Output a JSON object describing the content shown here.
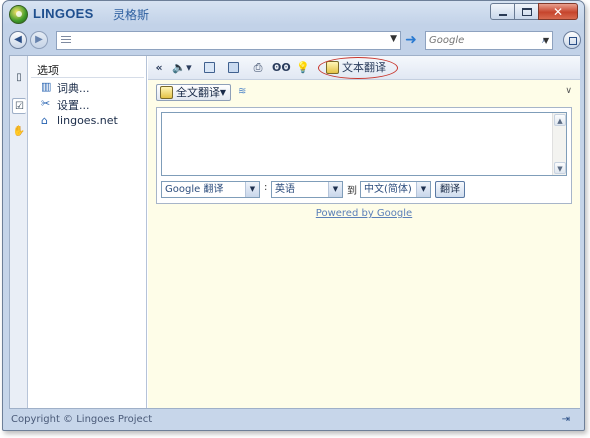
{
  "window": {
    "title": "LINGOES",
    "title_cn": "灵格斯",
    "controls": [
      "minimize",
      "maximize",
      "close"
    ]
  },
  "address": {
    "value": "",
    "search_placeholder": "Google"
  },
  "sidebar": {
    "header": "选项",
    "items": [
      {
        "label": "词典...",
        "icon": "dictionary-icon"
      },
      {
        "label": "设置...",
        "icon": "tools-icon"
      },
      {
        "label": "lingoes.net",
        "icon": "home-icon"
      }
    ]
  },
  "toolbar": {
    "collapse": "«",
    "text_translate": "文本翻译"
  },
  "translate": {
    "mode_label": "全文翻译",
    "engine": "Google 翻译",
    "colon": ":",
    "from_lang": "英语",
    "to_word": "到",
    "to_lang": "中文(简体)",
    "button": "翻译",
    "powered_by": "Powered by Google"
  },
  "status": {
    "text": "Copyright © Lingoes Project"
  },
  "colors": {
    "highlight_ring": "#c8352c",
    "main_bg": "#fefde8",
    "link": "#5a7fb8"
  }
}
